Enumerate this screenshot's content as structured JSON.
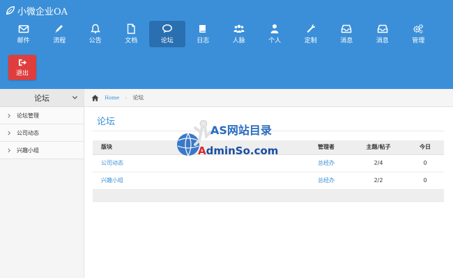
{
  "app": {
    "title": "小微企业OA"
  },
  "nav": [
    {
      "label": "邮件",
      "icon": "mail-icon"
    },
    {
      "label": "流程",
      "icon": "pencil-icon"
    },
    {
      "label": "公告",
      "icon": "bell-icon"
    },
    {
      "label": "文档",
      "icon": "document-icon"
    },
    {
      "label": "论坛",
      "icon": "chat-icon",
      "active": true
    },
    {
      "label": "日志",
      "icon": "book-icon"
    },
    {
      "label": "人脉",
      "icon": "group-icon"
    },
    {
      "label": "个人",
      "icon": "user-icon"
    },
    {
      "label": "定制",
      "icon": "wrench-icon"
    },
    {
      "label": "消息",
      "icon": "inbox-icon"
    },
    {
      "label": "消息",
      "icon": "inbox-icon"
    },
    {
      "label": "管理",
      "icon": "gears-icon"
    }
  ],
  "logout": {
    "label": "退出"
  },
  "sidebar": {
    "title": "论坛",
    "items": [
      "论坛管理",
      "公司动态",
      "兴趣小组"
    ]
  },
  "breadcrumb": {
    "home": "Home",
    "current": "论坛"
  },
  "page": {
    "title": "论坛"
  },
  "table": {
    "headers": {
      "board": "版块",
      "manager": "管理者",
      "topics_posts": "主题/帖子",
      "today": "今日"
    },
    "rows": [
      {
        "board": "公司动态",
        "manager": "总经办",
        "topics_posts": "2/4",
        "today": "0"
      },
      {
        "board": "兴趣小组",
        "manager": "总经办",
        "topics_posts": "2/2",
        "today": "0"
      }
    ]
  },
  "watermark": {
    "line1": "AS网站目录",
    "line2_a": "A",
    "line2_b": "dminSo.com"
  },
  "colors": {
    "header": "#3a8fd8",
    "active_nav": "#2a6fb0",
    "logout": "#e03d3d",
    "link": "#3a8fd8"
  }
}
